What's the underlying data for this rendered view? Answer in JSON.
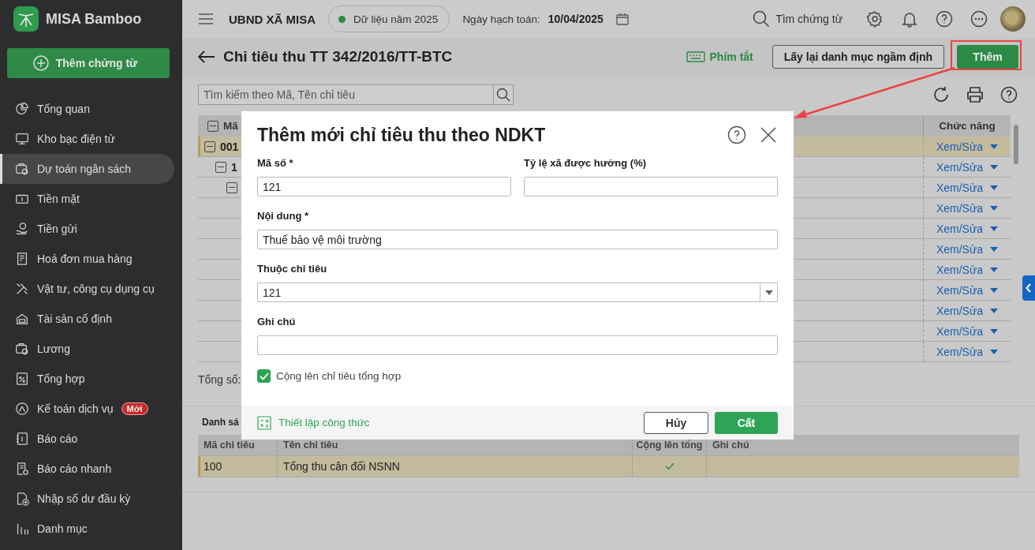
{
  "app": {
    "name": "MISA Bamboo",
    "new_button": "Thêm chứng từ"
  },
  "sidebar": {
    "items": [
      {
        "label": "Tổng quan",
        "selected": false
      },
      {
        "label": "Kho bạc điện tử",
        "selected": false
      },
      {
        "label": "Dự toán ngân sách",
        "selected": true
      },
      {
        "label": "Tiền mặt",
        "selected": false
      },
      {
        "label": "Tiền gửi",
        "selected": false
      },
      {
        "label": "Hoá đơn mua hàng",
        "selected": false
      },
      {
        "label": "Vật tư, công cụ dụng cụ",
        "selected": false
      },
      {
        "label": "Tài sản cố định",
        "selected": false
      },
      {
        "label": "Lương",
        "selected": false
      },
      {
        "label": "Tổng hợp",
        "selected": false
      },
      {
        "label": "Kế toán dịch vụ",
        "selected": false,
        "badge": "Mới"
      },
      {
        "label": "Báo cáo",
        "selected": false
      },
      {
        "label": "Báo cáo nhanh",
        "selected": false
      },
      {
        "label": "Nhập số dư đầu kỳ",
        "selected": false
      },
      {
        "label": "Danh mục",
        "selected": false
      }
    ]
  },
  "topbar": {
    "org": "UBND XÃ MISA",
    "data_year": "Dữ liệu năm 2025",
    "date_label": "Ngày hạch toán:",
    "date": "10/04/2025",
    "search": "Tìm chứng từ"
  },
  "page": {
    "title": "Chỉ tiêu thu TT 342/2016/TT-BTC",
    "shortcuts": "Phím tắt",
    "reset_button": "Lấy lại danh mục ngầm định",
    "add_button": "Thêm",
    "search": {
      "placeholder": "Tìm kiếm theo Mã, Tên chỉ tiêu"
    }
  },
  "table": {
    "columns": [
      {
        "label": "Mã",
        "expanded": true
      },
      {
        "label": "Chức năng"
      }
    ],
    "rows": [
      {
        "code": "001",
        "expanded": true,
        "selected": true,
        "action": "Xem/Sửa",
        "children": [
          {
            "code": "1",
            "expanded": true,
            "selected": false,
            "action": "Xem/Sửa",
            "children": [
              {
                "expanded": true,
                "selected": false,
                "action": "Xem/Sửa"
              }
            ]
          }
        ]
      },
      {
        "selected": false,
        "action": "Xem/Sửa"
      },
      {
        "selected": false,
        "action": "Xem/Sửa"
      },
      {
        "selected": false,
        "action": "Xem/Sửa"
      },
      {
        "selected": false,
        "action": "Xem/Sửa"
      },
      {
        "selected": false,
        "action": "Xem/Sửa"
      },
      {
        "selected": false,
        "action": "Xem/Sửa"
      },
      {
        "selected": false,
        "action": "Xem/Sửa"
      },
      {
        "selected": false,
        "action": "Xem/Sửa"
      }
    ]
  },
  "total_label": "Tổng số:",
  "detail": {
    "title": "Danh sá",
    "columns": [
      "Mã chỉ tiêu",
      "Tên chỉ tiêu",
      "Cộng lên tổng",
      "Ghi chú"
    ],
    "rows": [
      {
        "code": "100",
        "name": "Tổng thu cân đối NSNN",
        "rollup": true,
        "selected": true
      }
    ]
  },
  "dialog": {
    "title": "Thêm mới chỉ tiêu thu theo NDKT",
    "fields": [
      {
        "label": "Mã số *",
        "value": "121",
        "kind": "text"
      },
      {
        "label": "Tỷ lệ xã được hưởng (%)",
        "kind": "text"
      },
      {
        "label": "Nội dung *",
        "value": "Thuế bảo vệ môi trường",
        "kind": "text"
      },
      {
        "label": "Thuộc chỉ tiêu",
        "value": "121",
        "kind": "select"
      },
      {
        "label": "Ghi chú",
        "kind": "text"
      }
    ],
    "checkbox": {
      "label": "Cộng lên chỉ tiêu tổng hợp",
      "checked": true
    },
    "formula_link": "Thiết lập công thức",
    "cancel": "Hủy",
    "save": "Cất"
  }
}
